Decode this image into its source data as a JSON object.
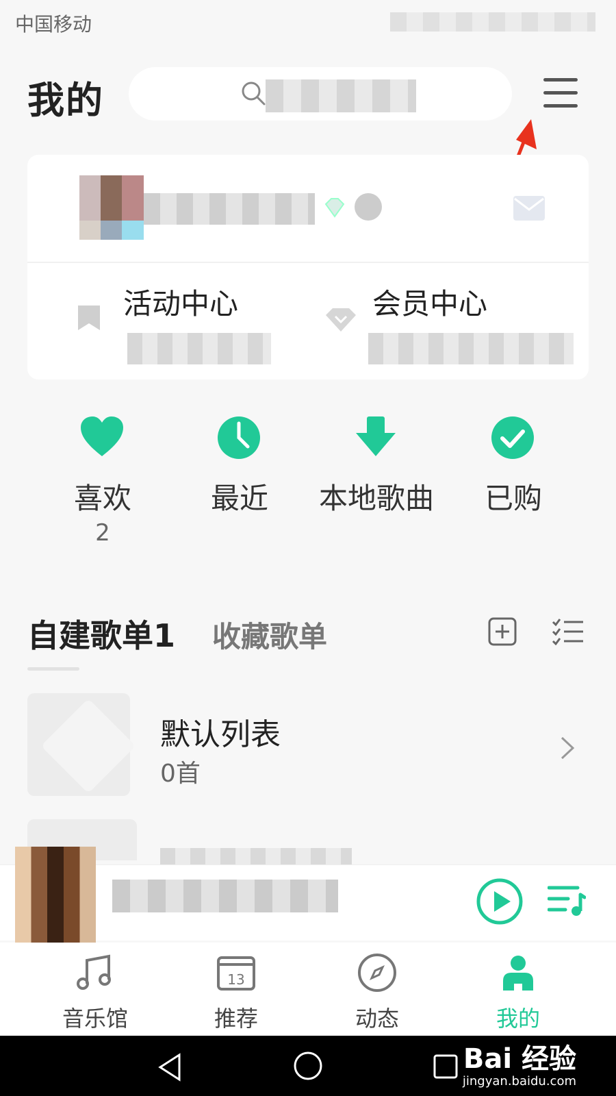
{
  "status_bar": {
    "carrier": "中国移动"
  },
  "header": {
    "title": "我的"
  },
  "profile": {
    "activity_center": "活动中心",
    "member_center": "会员中心"
  },
  "quick_actions": [
    {
      "label": "喜欢",
      "count": "2"
    },
    {
      "label": "最近"
    },
    {
      "label": "本地歌曲"
    },
    {
      "label": "已购"
    }
  ],
  "playlist_tabs": {
    "created": "自建歌单1",
    "collected": "收藏歌单"
  },
  "playlists": [
    {
      "title": "默认列表",
      "count": "0首"
    }
  ],
  "bottom_nav": [
    {
      "label": "音乐馆",
      "icon": "music-note-icon"
    },
    {
      "label": "推荐",
      "icon": "calendar-icon",
      "badge": "13"
    },
    {
      "label": "动态",
      "icon": "compass-icon"
    },
    {
      "label": "我的",
      "icon": "person-icon",
      "active": true
    }
  ],
  "watermark": {
    "brand": "Bai 经验",
    "url": "jingyan.baidu.com"
  },
  "colors": {
    "accent": "#21c997",
    "annotation_arrow": "#e8321e"
  }
}
